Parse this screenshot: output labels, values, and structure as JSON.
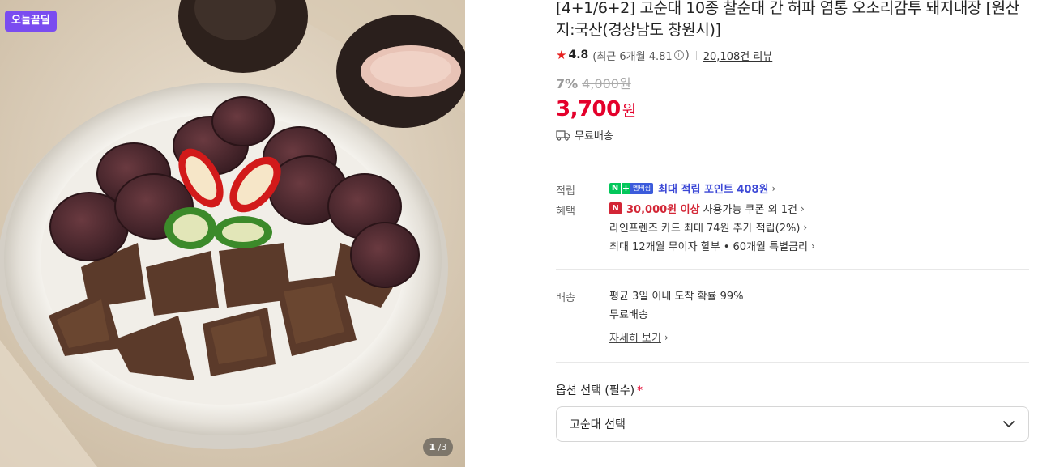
{
  "gallery": {
    "badge": "오늘끝딜",
    "pager_current": "1",
    "pager_total": "3"
  },
  "product": {
    "title": "[4+1/6+2] 고순대 10종 찰순대 간 허파 염통 오소리감투 돼지내장 [원산지:국산(경상남도 창원시)]",
    "rating": "4.8",
    "recent_rating": "(최근 6개월 4.81",
    "recent_close": ")",
    "review_count": "20,108건 리뷰",
    "discount_pct": "7%",
    "original_price": "4,000원",
    "price": "3,700",
    "price_unit": "원",
    "shipping_short": "무료배송"
  },
  "points": {
    "label": "적립",
    "badge_n": "N",
    "badge_plus": "+",
    "badge_member": "멤버십",
    "text": "최대 적립 포인트 408원"
  },
  "benefits": {
    "label": "혜택",
    "badge_n": "N",
    "coupon_amount": "30,000원 이상",
    "coupon_text": "사용가능 쿠폰 외 1건",
    "card_text": "라인프렌즈 카드 최대 74원 추가 적립(2%)",
    "installment_text": "최대 12개월 무이자 할부 • 60개월 특별금리"
  },
  "delivery": {
    "label": "배송",
    "arrival": "평균 3일 이내 도착 확률 99%",
    "fee": "무료배송",
    "details_link": "자세히 보기"
  },
  "option": {
    "label": "옵션 선택 (필수)",
    "required_mark": "*",
    "selected": "고순대 선택"
  },
  "colors": {
    "accent_red": "#e4002b",
    "deal_purple": "#7a4cf0",
    "naver_green": "#03c75a",
    "point_blue": "#3c48d6"
  },
  "icons": [
    "star-icon",
    "info-icon",
    "truck-icon",
    "chevron-right-icon",
    "chevron-down-icon"
  ]
}
